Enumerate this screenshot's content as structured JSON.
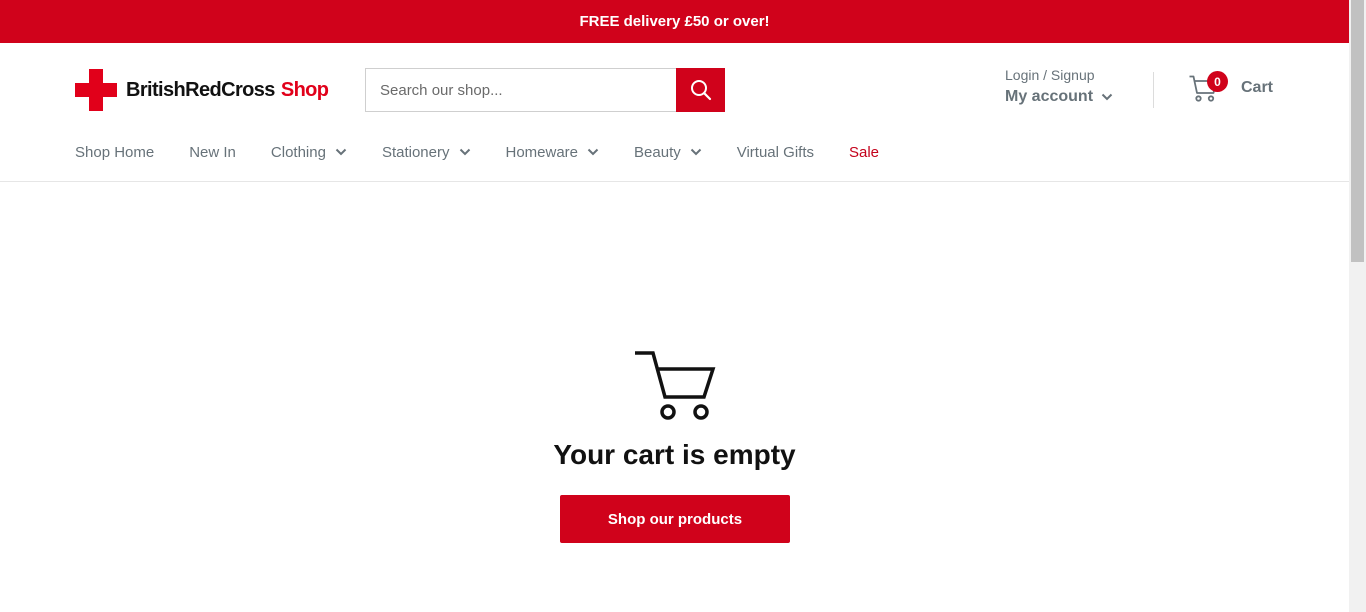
{
  "promo": {
    "text": "FREE delivery £50 or over!"
  },
  "logo": {
    "brand": "BritishRedCross",
    "shop": "Shop"
  },
  "search": {
    "placeholder": "Search our shop..."
  },
  "account": {
    "login_label": "Login / Signup",
    "my_account_label": "My account"
  },
  "cart": {
    "count": "0",
    "label": "Cart"
  },
  "nav": {
    "items": [
      {
        "label": "Shop Home"
      },
      {
        "label": "New In"
      },
      {
        "label": "Clothing"
      },
      {
        "label": "Stationery"
      },
      {
        "label": "Homeware"
      },
      {
        "label": "Beauty"
      },
      {
        "label": "Virtual Gifts"
      },
      {
        "label": "Sale"
      }
    ]
  },
  "empty_state": {
    "title": "Your cart is empty",
    "button_label": "Shop our products"
  },
  "colors": {
    "brand_red": "#d0021b",
    "nav_text": "#677279"
  },
  "icons": [
    "logo-cross-icon",
    "search-icon",
    "chevron-down-icon",
    "cart-icon"
  ]
}
